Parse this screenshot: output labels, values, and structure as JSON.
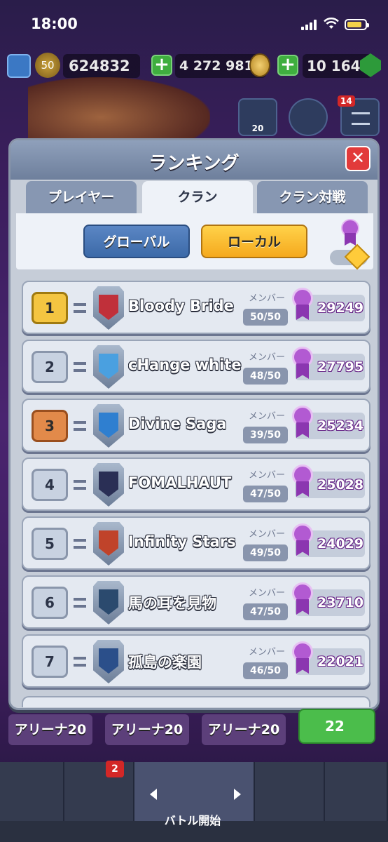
{
  "status": {
    "time": "18:00"
  },
  "resources": {
    "level": "50",
    "trophies": "624832",
    "gold": "4 272 981",
    "gems": "10 164"
  },
  "top_buttons": {
    "friends_count": "20",
    "menu_badge": "14"
  },
  "ranking": {
    "title": "ランキング",
    "close_label": "✕",
    "tabs": [
      "プレイヤー",
      "クラン",
      "クラン対戦"
    ],
    "filters": {
      "global": "グローバル",
      "local": "ローカル"
    },
    "member_label": "メンバー",
    "rows": [
      {
        "rank": "1",
        "name": "Bloody Bride",
        "members": "50/50",
        "trophies": "29249",
        "rank_style": "gold",
        "badge_color": "#c0303a"
      },
      {
        "rank": "2",
        "name": "cHange white",
        "members": "48/50",
        "trophies": "27795",
        "rank_style": "plain",
        "badge_color": "#4aa0e0"
      },
      {
        "rank": "3",
        "name": "Divine Saga",
        "members": "39/50",
        "trophies": "25234",
        "rank_style": "bronze",
        "badge_color": "#2f7fd0"
      },
      {
        "rank": "4",
        "name": "FOMALHAUT",
        "members": "47/50",
        "trophies": "25028",
        "rank_style": "plain",
        "badge_color": "#2a2f55"
      },
      {
        "rank": "5",
        "name": "Infinity Stars",
        "members": "49/50",
        "trophies": "24029",
        "rank_style": "plain",
        "badge_color": "#c0432a"
      },
      {
        "rank": "6",
        "name": "馬の耳を見物",
        "members": "47/50",
        "trophies": "23710",
        "rank_style": "plain",
        "badge_color": "#2b4a6e"
      },
      {
        "rank": "7",
        "name": "孤島の楽園",
        "members": "46/50",
        "trophies": "22021",
        "rank_style": "plain",
        "badge_color": "#2b4f8a"
      }
    ]
  },
  "arenas": [
    "アリーナ20",
    "アリーナ20",
    "アリーナ20"
  ],
  "gem_button": "22",
  "nav": {
    "cards_badge": "2",
    "battle_label": "バトル開始"
  }
}
